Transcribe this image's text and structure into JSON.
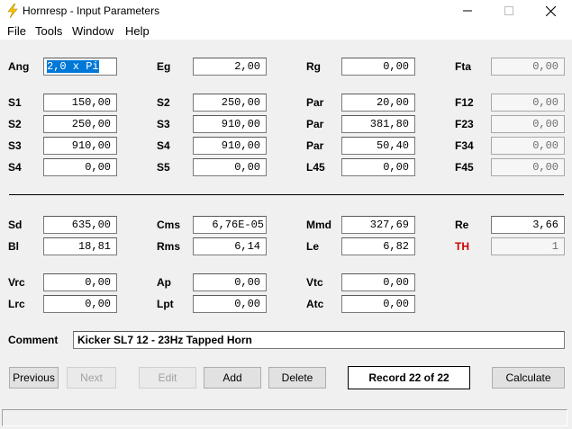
{
  "window": {
    "title": "Hornresp - Input Parameters",
    "icon": "lightning-bolt-icon"
  },
  "menu": [
    "File",
    "Tools",
    "Window",
    "Help"
  ],
  "params": {
    "Ang": {
      "label": "Ang",
      "value": "2,0 x Pi"
    },
    "Eg": {
      "label": "Eg",
      "value": "2,00"
    },
    "Rg": {
      "label": "Rg",
      "value": "0,00"
    },
    "Fta": {
      "label": "Fta",
      "value": "0,00"
    },
    "S1": {
      "label": "S1",
      "value": "150,00"
    },
    "S2a": {
      "label": "S2",
      "value": "250,00"
    },
    "Par1": {
      "label": "Par",
      "value": "20,00"
    },
    "F12": {
      "label": "F12",
      "value": "0,00"
    },
    "S2": {
      "label": "S2",
      "value": "250,00"
    },
    "S3a": {
      "label": "S3",
      "value": "910,00"
    },
    "Par2": {
      "label": "Par",
      "value": "381,80"
    },
    "F23": {
      "label": "F23",
      "value": "0,00"
    },
    "S3": {
      "label": "S3",
      "value": "910,00"
    },
    "S4a": {
      "label": "S4",
      "value": "910,00"
    },
    "Par3": {
      "label": "Par",
      "value": "50,40"
    },
    "F34": {
      "label": "F34",
      "value": "0,00"
    },
    "S4": {
      "label": "S4",
      "value": "0,00"
    },
    "S5": {
      "label": "S5",
      "value": "0,00"
    },
    "L45": {
      "label": "L45",
      "value": "0,00"
    },
    "F45": {
      "label": "F45",
      "value": "0,00"
    },
    "Sd": {
      "label": "Sd",
      "value": "635,00"
    },
    "Cms": {
      "label": "Cms",
      "value": "6,76E-05"
    },
    "Mmd": {
      "label": "Mmd",
      "value": "327,69"
    },
    "Re": {
      "label": "Re",
      "value": "3,66"
    },
    "Bl": {
      "label": "Bl",
      "value": "18,81"
    },
    "Rms": {
      "label": "Rms",
      "value": "6,14"
    },
    "Le": {
      "label": "Le",
      "value": "6,82"
    },
    "TH": {
      "label": "TH",
      "value": "1"
    },
    "Vrc": {
      "label": "Vrc",
      "value": "0,00"
    },
    "Ap": {
      "label": "Ap",
      "value": "0,00"
    },
    "Vtc": {
      "label": "Vtc",
      "value": "0,00"
    },
    "Lrc": {
      "label": "Lrc",
      "value": "0,00"
    },
    "Lpt": {
      "label": "Lpt",
      "value": "0,00"
    },
    "Atc": {
      "label": "Atc",
      "value": "0,00"
    }
  },
  "comment": {
    "label": "Comment",
    "value": "Kicker SL7 12 - 23Hz Tapped Horn"
  },
  "buttons": {
    "previous": "Previous",
    "next": "Next",
    "edit": "Edit",
    "add": "Add",
    "delete": "Delete",
    "record": "Record 22 of 22",
    "calculate": "Calculate"
  },
  "colors": {
    "selection": "#0078d7",
    "th_label": "#cc0000",
    "icon": "#f5c400"
  }
}
